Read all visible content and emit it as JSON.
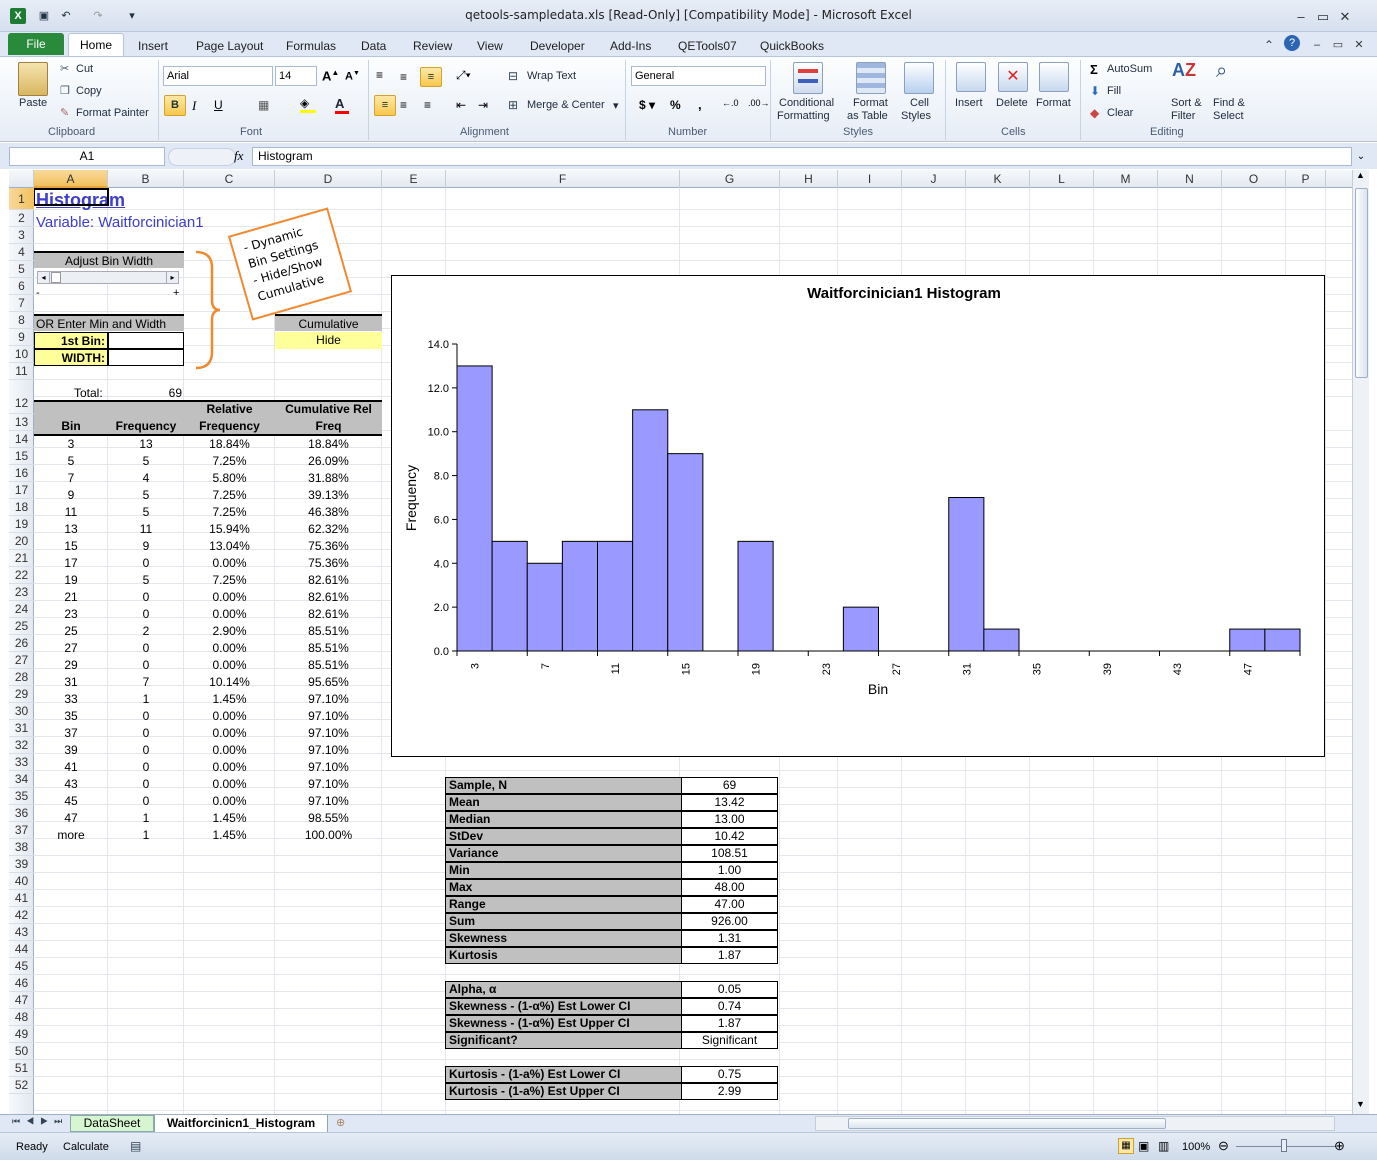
{
  "window": {
    "title": "qetools-sampledata.xls  [Read-Only]  [Compatibility Mode]  -  Microsoft Excel"
  },
  "ribbon_tabs": [
    "File",
    "Home",
    "Insert",
    "Page Layout",
    "Formulas",
    "Data",
    "Review",
    "View",
    "Developer",
    "Add-Ins",
    "QETools07",
    "QuickBooks"
  ],
  "ribbon": {
    "clipboard": {
      "paste": "Paste",
      "cut": "Cut",
      "copy": "Copy",
      "format_painter": "Format Painter",
      "label": "Clipboard"
    },
    "font": {
      "name": "Arial",
      "size": "14",
      "label": "Font"
    },
    "alignment": {
      "wrap_text": "Wrap Text",
      "merge_center": "Merge & Center",
      "label": "Alignment"
    },
    "number": {
      "format": "General",
      "label": "Number"
    },
    "styles": {
      "conditional": "Conditional",
      "formatting": "Formatting",
      "format": "Format",
      "as_table": "as Table",
      "cell": "Cell",
      "styles": "Styles",
      "label": "Styles"
    },
    "cells": {
      "insert": "Insert",
      "delete": "Delete",
      "format": "Format",
      "label": "Cells"
    },
    "editing": {
      "autosum": "AutoSum",
      "fill": "Fill",
      "clear": "Clear",
      "sort": "Sort &",
      "filter": "Filter",
      "find": "Find &",
      "select": "Select",
      "label": "Editing"
    }
  },
  "formula_bar": {
    "name_box": "A1",
    "fx": "fx",
    "content": "Histogram"
  },
  "columns": [
    "A",
    "B",
    "C",
    "D",
    "E",
    "F",
    "G",
    "H",
    "I",
    "J",
    "K",
    "L",
    "M",
    "N",
    "O",
    "P"
  ],
  "rows": [
    "1",
    "2",
    "3",
    "4",
    "5",
    "6",
    "7",
    "8",
    "9",
    "10",
    "11",
    "12",
    "13",
    "14",
    "15",
    "16",
    "17",
    "18",
    "19",
    "20",
    "21",
    "22",
    "23",
    "24",
    "25",
    "26",
    "27",
    "28",
    "29",
    "30",
    "31",
    "32",
    "33",
    "34",
    "35",
    "36",
    "37",
    "38",
    "39",
    "40",
    "41",
    "42",
    "43",
    "44",
    "45",
    "46",
    "47",
    "48",
    "49",
    "50",
    "51",
    "52"
  ],
  "sheet": {
    "title": "Histogram",
    "variable": "Variable:  Waitforcinician1",
    "adjust_bin_width": "Adjust Bin Width",
    "minus": "-",
    "plus": "+",
    "or_enter": "OR Enter Min and Width",
    "first_bin": "1st Bin:",
    "width": "WIDTH:",
    "cumulative": "Cumulative",
    "hide": "Hide",
    "total_label": "Total:",
    "total_value": "69",
    "callout": [
      "- Dynamic",
      "Bin Settings",
      "- Hide/Show",
      "Cumulative"
    ],
    "headers": {
      "bin": "Bin",
      "frequency": "Frequency",
      "relative_1": "Relative",
      "relative_2": "Frequency",
      "cumrel_1": "Cumulative Rel",
      "cumrel_2": "Freq"
    },
    "table": [
      [
        "3",
        "13",
        "18.84%",
        "18.84%"
      ],
      [
        "5",
        "5",
        "7.25%",
        "26.09%"
      ],
      [
        "7",
        "4",
        "5.80%",
        "31.88%"
      ],
      [
        "9",
        "5",
        "7.25%",
        "39.13%"
      ],
      [
        "11",
        "5",
        "7.25%",
        "46.38%"
      ],
      [
        "13",
        "11",
        "15.94%",
        "62.32%"
      ],
      [
        "15",
        "9",
        "13.04%",
        "75.36%"
      ],
      [
        "17",
        "0",
        "0.00%",
        "75.36%"
      ],
      [
        "19",
        "5",
        "7.25%",
        "82.61%"
      ],
      [
        "21",
        "0",
        "0.00%",
        "82.61%"
      ],
      [
        "23",
        "0",
        "0.00%",
        "82.61%"
      ],
      [
        "25",
        "2",
        "2.90%",
        "85.51%"
      ],
      [
        "27",
        "0",
        "0.00%",
        "85.51%"
      ],
      [
        "29",
        "0",
        "0.00%",
        "85.51%"
      ],
      [
        "31",
        "7",
        "10.14%",
        "95.65%"
      ],
      [
        "33",
        "1",
        "1.45%",
        "97.10%"
      ],
      [
        "35",
        "0",
        "0.00%",
        "97.10%"
      ],
      [
        "37",
        "0",
        "0.00%",
        "97.10%"
      ],
      [
        "39",
        "0",
        "0.00%",
        "97.10%"
      ],
      [
        "41",
        "0",
        "0.00%",
        "97.10%"
      ],
      [
        "43",
        "0",
        "0.00%",
        "97.10%"
      ],
      [
        "45",
        "0",
        "0.00%",
        "97.10%"
      ],
      [
        "47",
        "1",
        "1.45%",
        "98.55%"
      ],
      [
        "more",
        "1",
        "1.45%",
        "100.00%"
      ]
    ],
    "stats": [
      [
        "Sample, N",
        "69"
      ],
      [
        "Mean",
        "13.42"
      ],
      [
        "Median",
        "13.00"
      ],
      [
        "StDev",
        "10.42"
      ],
      [
        "Variance",
        "108.51"
      ],
      [
        "Min",
        "1.00"
      ],
      [
        "Max",
        "48.00"
      ],
      [
        "Range",
        "47.00"
      ],
      [
        "Sum",
        "926.00"
      ],
      [
        "Skewness",
        "1.31"
      ],
      [
        "Kurtosis",
        "1.87"
      ]
    ],
    "stats2": [
      [
        "Alpha, α",
        "0.05"
      ],
      [
        "Skewness - (1-α%) Est Lower CI",
        "0.74"
      ],
      [
        "Skewness - (1-α%) Est Upper CI",
        "1.87"
      ],
      [
        "Significant?",
        "Significant"
      ]
    ],
    "stats3": [
      [
        "Kurtosis - (1-a%) Est Lower CI",
        "0.75"
      ],
      [
        "Kurtosis - (1-a%) Est Upper CI",
        "2.99"
      ]
    ]
  },
  "chart_data": {
    "type": "bar",
    "title": "Waitforcinician1  Histogram",
    "xlabel": "Bin",
    "ylabel": "Frequency",
    "categories": [
      "3",
      "5",
      "7",
      "9",
      "11",
      "13",
      "15",
      "17",
      "19",
      "21",
      "23",
      "25",
      "27",
      "29",
      "31",
      "33",
      "35",
      "37",
      "39",
      "41",
      "43",
      "45",
      "47",
      "more"
    ],
    "values": [
      13,
      5,
      4,
      5,
      5,
      11,
      9,
      0,
      5,
      0,
      0,
      2,
      0,
      0,
      7,
      1,
      0,
      0,
      0,
      0,
      0,
      0,
      1,
      1
    ],
    "x_tick_labels": [
      "3",
      "7",
      "11",
      "15",
      "19",
      "23",
      "27",
      "31",
      "35",
      "39",
      "43",
      "47"
    ],
    "y_ticks": [
      "0.0",
      "2.0",
      "4.0",
      "6.0",
      "8.0",
      "10.0",
      "12.0",
      "14.0"
    ],
    "ylim": [
      0,
      14
    ],
    "bar_color": "#9999ff"
  },
  "sheet_tabs": [
    "DataSheet",
    "Waitforcinicn1_Histogram"
  ],
  "status": {
    "ready": "Ready",
    "calculate": "Calculate",
    "zoom": "100%"
  }
}
